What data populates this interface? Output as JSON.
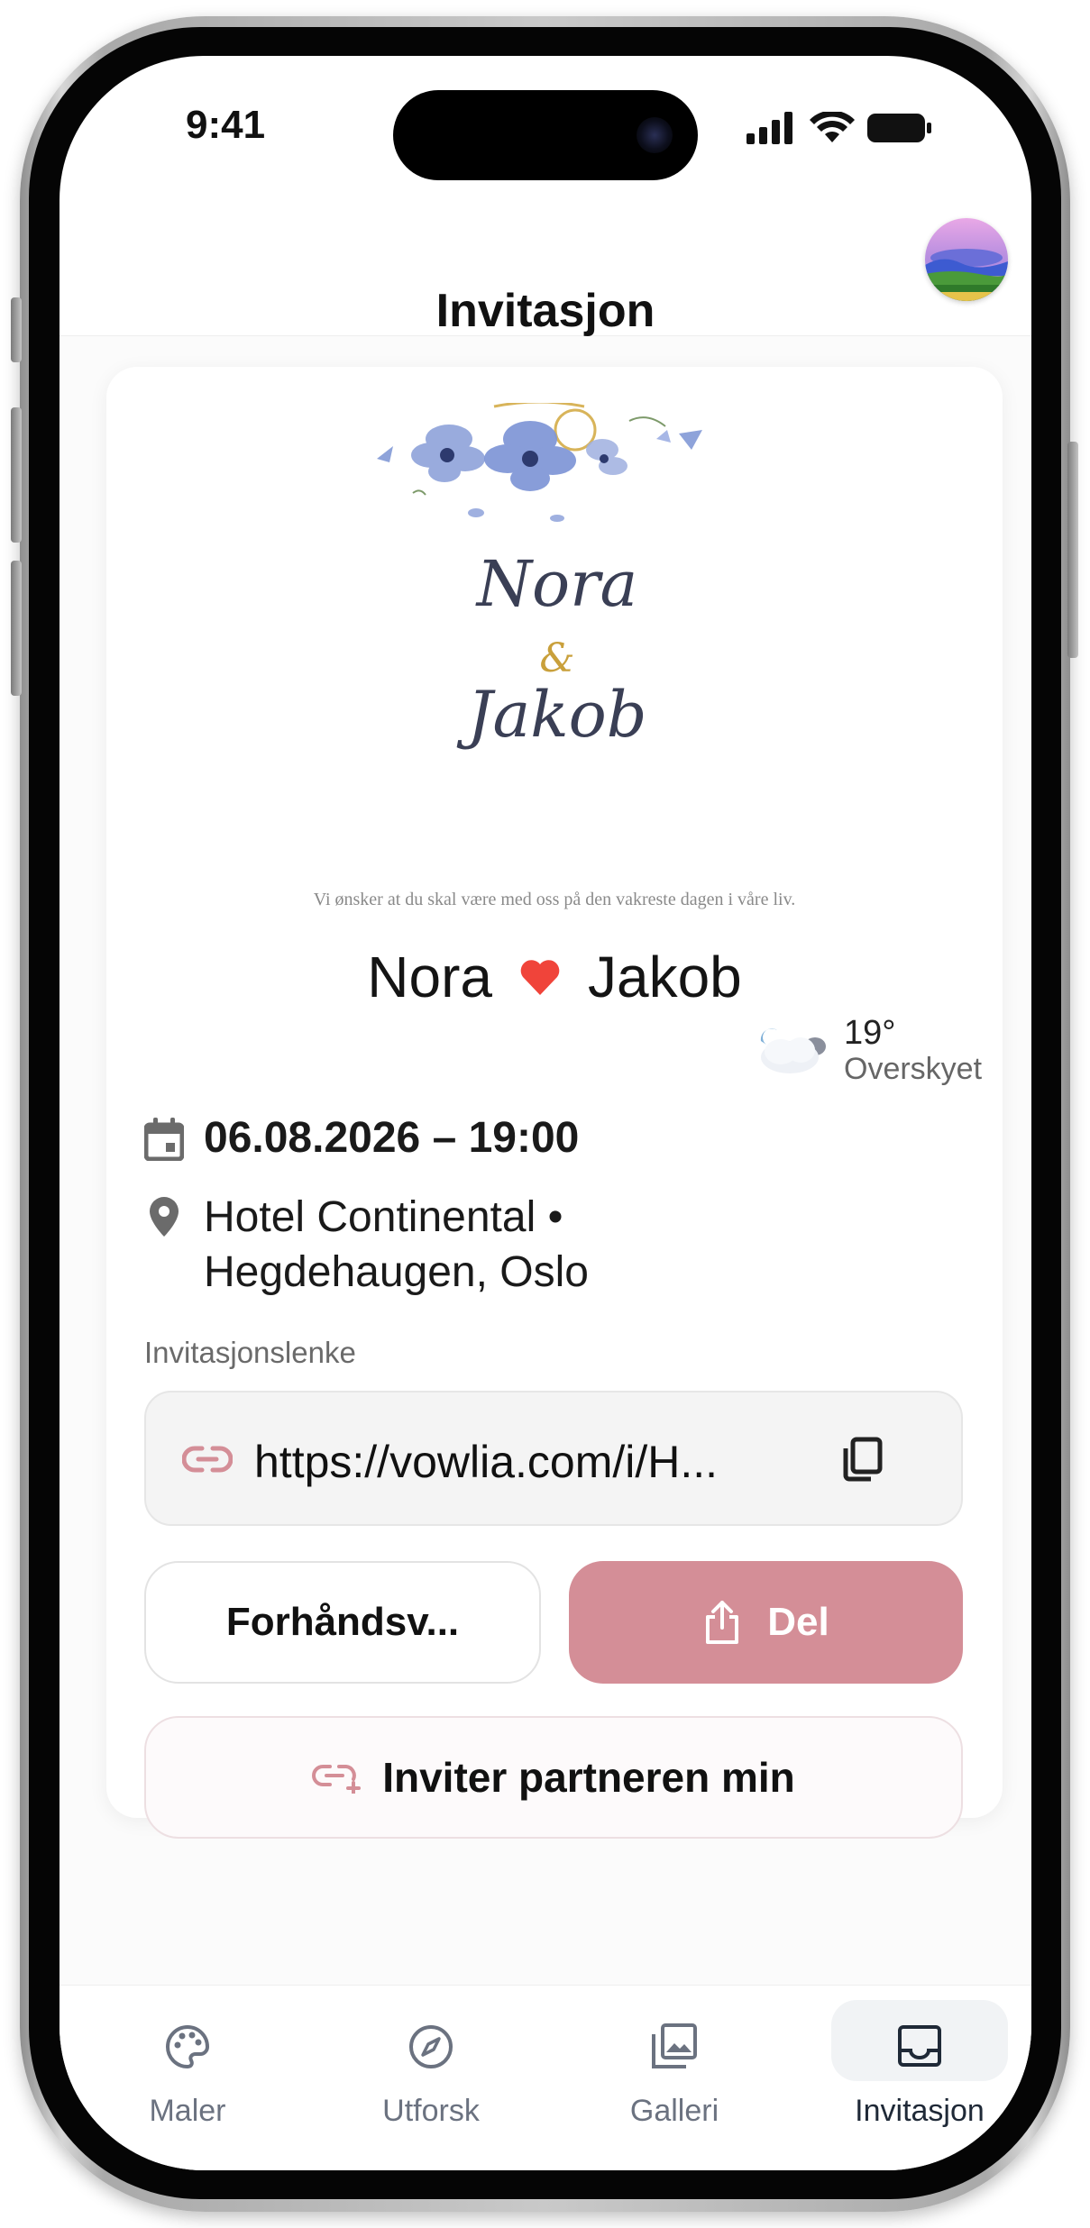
{
  "status_bar": {
    "time": "9:41"
  },
  "header": {
    "title": "Invitasjon"
  },
  "invitation": {
    "image_name1": "Nora",
    "image_ampersand": "&",
    "image_name2": "Jakob",
    "tagline": "Vi ønsker at du skal være med oss på den vakreste dagen i våre liv.",
    "name1": "Nora",
    "name2": "Jakob",
    "heart_color": "#f0443a"
  },
  "weather": {
    "temp": "19°",
    "description": "Overskyet"
  },
  "details": {
    "datetime": "06.08.2026 – 19:00",
    "location_line1": "Hotel Continental •",
    "location_line2": "Hegdehaugen, Oslo"
  },
  "link": {
    "label": "Invitasjonslenke",
    "url": "https://vowlia.com/i/H..."
  },
  "buttons": {
    "preview": "Forhåndsv...",
    "share": "Del",
    "invite_partner": "Inviter partneren min"
  },
  "accent_color": "#d48e97",
  "tabs": [
    {
      "label": "Maler",
      "icon": "palette-icon"
    },
    {
      "label": "Utforsk",
      "icon": "compass-icon"
    },
    {
      "label": "Galleri",
      "icon": "gallery-icon"
    },
    {
      "label": "Invitasjon",
      "icon": "inbox-icon",
      "active": true
    }
  ]
}
